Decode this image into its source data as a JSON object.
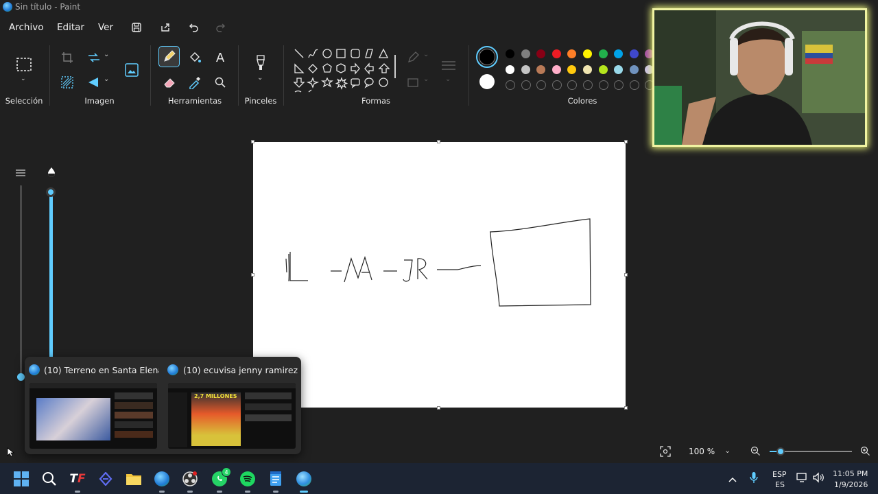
{
  "window": {
    "title": "Sin título - Paint"
  },
  "menu": {
    "file": "Archivo",
    "edit": "Editar",
    "view": "Ver"
  },
  "ribbon": {
    "groups": {
      "selection": "Selección",
      "image": "Imagen",
      "tools": "Herramientas",
      "brushes": "Pinceles",
      "shapes": "Formas",
      "colors": "Colores"
    }
  },
  "colors": {
    "primary": "#000000",
    "secondary": "#ffffff",
    "accent": "#60cdff",
    "palette_row1": [
      "#000000",
      "#7f7f7f",
      "#880015",
      "#ed1c24",
      "#ff7f27",
      "#fff200",
      "#22b14c",
      "#00a2e8",
      "#3f48cc",
      "#a349a4"
    ],
    "palette_row2": [
      "#ffffff",
      "#c3c3c3",
      "#b97a57",
      "#ffaec9",
      "#ffc90e",
      "#efe4b0",
      "#b5e61d",
      "#99d9ea",
      "#7092be",
      "#c8bfe7"
    ]
  },
  "canvas": {
    "drawn_text": "L -MA-JR—"
  },
  "popup": {
    "items": [
      {
        "title": "(10) Terreno en Santa Elena..."
      },
      {
        "title": "(10) ecuvisa jenny ramirez..."
      }
    ],
    "thumb2_banner": "2,7 MILLONES"
  },
  "status": {
    "zoom": "100 %"
  },
  "taskbar": {
    "whatsapp_badge": "4",
    "language": "ESP",
    "layout": "ES",
    "time": "11:05 PM",
    "date": "1/9/2026"
  }
}
